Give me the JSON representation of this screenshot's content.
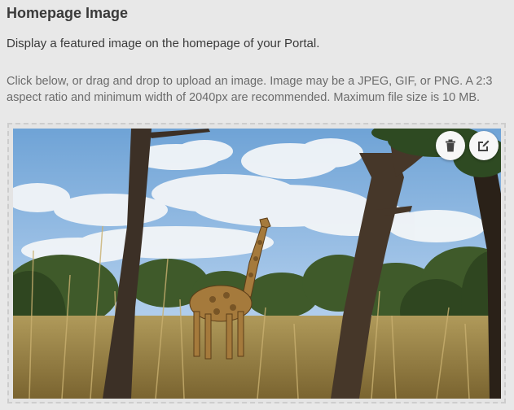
{
  "section": {
    "title": "Homepage Image",
    "description": "Display a featured image on the homepage of your Portal.",
    "instructions": "Click below, or drag and drop to upload an image. Image may be a JPEG, GIF, or PNG. A 2:3 aspect ratio and minimum width of 2040px are recommended. Maximum file size is 10 MB."
  },
  "image": {
    "subject": "giraffe in savanna",
    "actions": [
      {
        "icon": "trash-icon",
        "name": "delete-image"
      },
      {
        "icon": "edit-icon",
        "name": "edit-image"
      }
    ]
  },
  "colors": {
    "background": "#e8e8e8",
    "title": "#3a3a3a",
    "muted": "#6b6b6b",
    "dashed_border": "#cdcdcd",
    "button_bg": "#f7f7f7",
    "icon": "#444444"
  }
}
